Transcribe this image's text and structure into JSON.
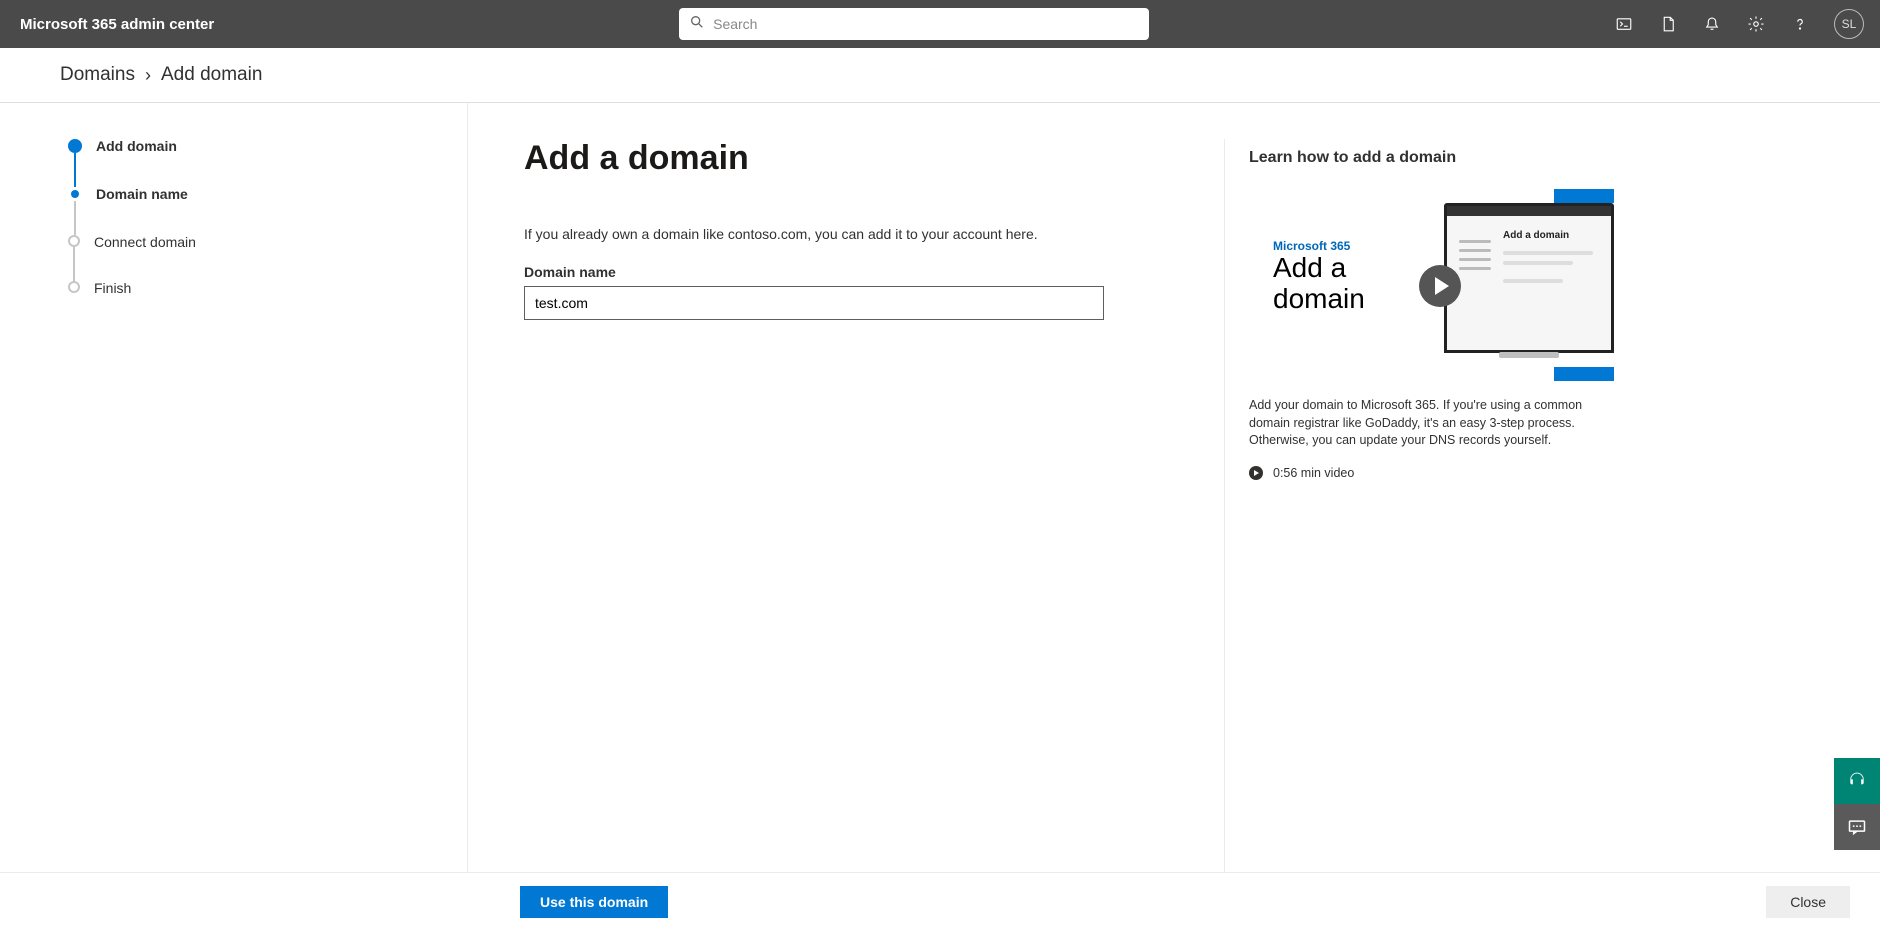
{
  "header": {
    "app_title": "Microsoft 365 admin center",
    "search_placeholder": "Search",
    "avatar_initials": "SL"
  },
  "breadcrumb": {
    "items": [
      "Domains"
    ],
    "current": "Add domain"
  },
  "steps": [
    {
      "label": "Add domain",
      "state": "completed"
    },
    {
      "label": "Domain name",
      "state": "current"
    },
    {
      "label": "Connect domain",
      "state": "pending"
    },
    {
      "label": "Finish",
      "state": "pending"
    }
  ],
  "main": {
    "title": "Add a domain",
    "lead": "If you already own a domain like contoso.com, you can add it to your account here.",
    "field_label": "Domain name",
    "field_value": "test.com"
  },
  "right": {
    "title": "Learn how to add a domain",
    "video_brand": "Microsoft 365",
    "video_caption": "Add a domain",
    "monitor_title": "Add a domain",
    "description": "Add your domain to Microsoft 365. If you're using a common domain registrar like GoDaddy, it's an easy 3-step process. Otherwise, you can update your DNS records yourself.",
    "video_length": "0:56 min video"
  },
  "footer": {
    "primary": "Use this domain",
    "close": "Close"
  }
}
